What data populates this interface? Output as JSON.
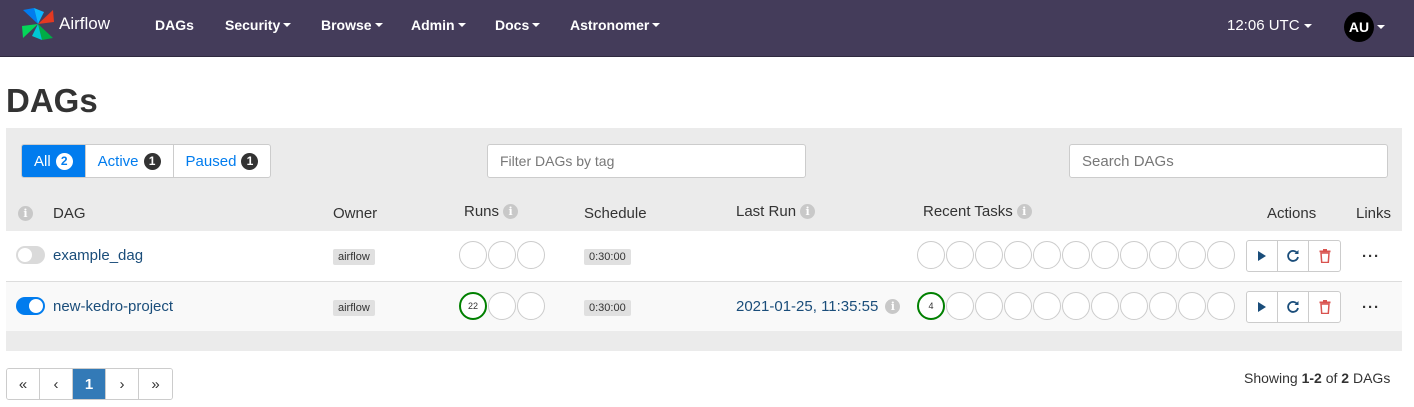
{
  "navbar": {
    "brand": "Airflow",
    "items": [
      "DAGs",
      "Security",
      "Browse",
      "Admin",
      "Docs",
      "Astronomer"
    ],
    "clock": "12:06 UTC",
    "user_initials": "AU"
  },
  "page_title": "DAGs",
  "filters": {
    "all_label": "All",
    "all_count": "2",
    "active_label": "Active",
    "active_count": "1",
    "paused_label": "Paused",
    "paused_count": "1",
    "tag_placeholder": "Filter DAGs by tag",
    "search_placeholder": "Search DAGs"
  },
  "table": {
    "headers": {
      "dag": "DAG",
      "owner": "Owner",
      "runs": "Runs",
      "schedule": "Schedule",
      "last_run": "Last Run",
      "recent_tasks": "Recent Tasks",
      "actions": "Actions",
      "links": "Links"
    },
    "rows": [
      {
        "name": "example_dag",
        "paused": true,
        "owner": "airflow",
        "schedule": "0:30:00",
        "runs_success": "",
        "last_run": "",
        "tasks_success": ""
      },
      {
        "name": "new-kedro-project",
        "paused": false,
        "owner": "airflow",
        "schedule": "0:30:00",
        "runs_success": "22",
        "last_run": "2021-01-25, 11:35:55",
        "tasks_success": "4"
      }
    ]
  },
  "pagination": {
    "pages": [
      "«",
      "‹",
      "1",
      "›",
      "»"
    ],
    "current": "1",
    "showing_prefix": "Showing",
    "range": "1-2",
    "of": "of",
    "total": "2",
    "suffix": "DAGs"
  },
  "colors": {
    "navbar": "#443c5a",
    "accent": "#017cee",
    "success": "#008000",
    "danger": "#d9534f"
  }
}
